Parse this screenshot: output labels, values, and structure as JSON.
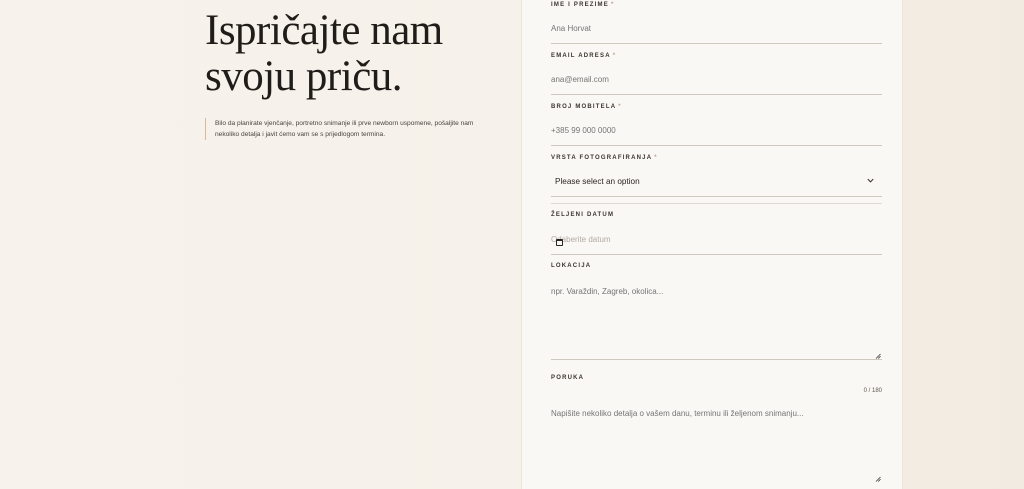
{
  "hero": {
    "title_line1": "Ispričajte nam",
    "title_line2": "svoju priču.",
    "intro": "Bilo da planirate vjenčanje, portretno snimanje ili prve newborn uspomene, pošaljite nam nekoliko detalja i javit ćemo vam se s prijedlogom termina."
  },
  "form": {
    "name": {
      "label": "IME I PREZIME",
      "required": "*",
      "placeholder": "Ana Horvat"
    },
    "email": {
      "label": "EMAIL ADRESA",
      "required": "*",
      "placeholder": "ana@email.com"
    },
    "phone": {
      "label": "BROJ MOBITELA",
      "required": "*",
      "placeholder": "+385 99 000 0000"
    },
    "type": {
      "label": "VRSTA FOTOGRAFIRANJA",
      "required": "*",
      "selected": "Please select an option"
    },
    "date": {
      "label": "ŽELJENI DATUM",
      "placeholder": "Odaberite datum"
    },
    "location": {
      "label": "LOKACIJA",
      "placeholder": "npr. Varaždin, Zagreb, okolica..."
    },
    "message": {
      "label": "PORUKA",
      "counter": "0 / 180",
      "placeholder": "Napišite nekoliko detalja o vašem danu, terminu ili željenom snimanju..."
    }
  },
  "colors": {
    "background": "#f6f1ea",
    "card": "#faf8f4",
    "accent": "#d9b99a",
    "required": "#c2a28a"
  }
}
